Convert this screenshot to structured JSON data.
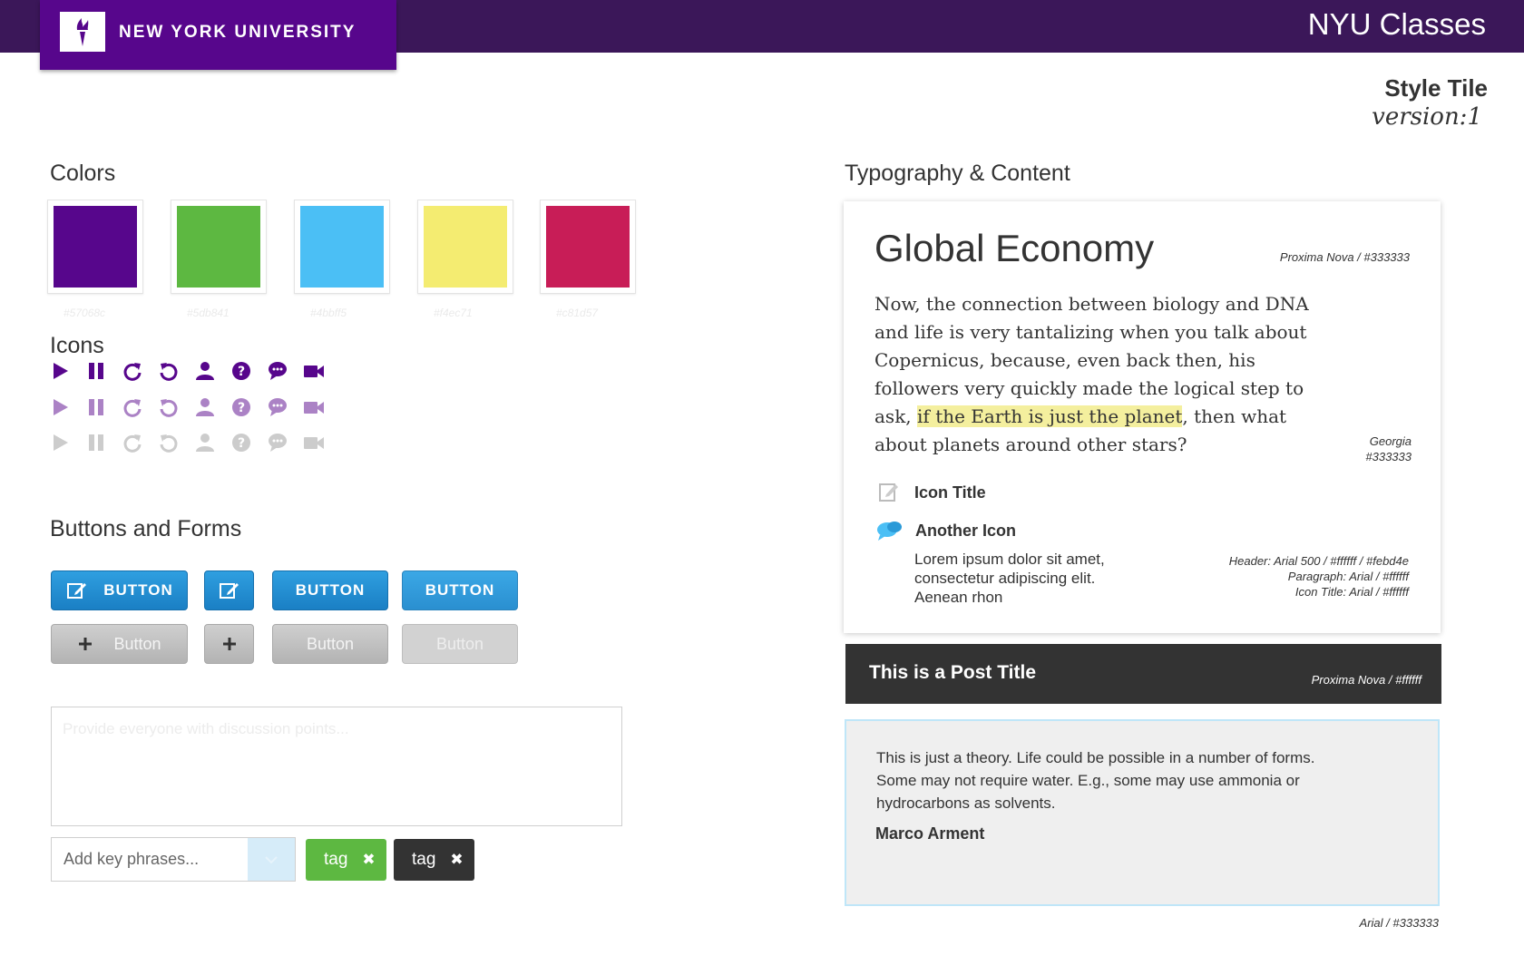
{
  "header": {
    "logo_text": "NEW YORK UNIVERSITY",
    "logo_icon": "torch-icon",
    "app_title": "NYU Classes",
    "tile_title": "Style Tile",
    "tile_version": "version:1"
  },
  "colors": {
    "title": "Colors",
    "swatches": [
      {
        "hex": "#57068c",
        "label": "#57068c"
      },
      {
        "hex": "#5db841",
        "label": "#5db841"
      },
      {
        "hex": "#4bbff5",
        "label": "#4bbff5"
      },
      {
        "hex": "#f4ec71",
        "label": "#f4ec71"
      },
      {
        "hex": "#c81d57",
        "label": "#c81d57"
      }
    ]
  },
  "icons": {
    "title": "Icons",
    "names": [
      "play-icon",
      "pause-icon",
      "redo-icon",
      "undo-icon",
      "user-icon",
      "help-icon",
      "chat-icon",
      "video-icon"
    ],
    "row_colors": [
      "#57068c",
      "#ab82c5",
      "#cccccc"
    ]
  },
  "forms": {
    "title": "Buttons and Forms",
    "button_label_caps": "BUTTON",
    "button_label": "Button",
    "textarea_placeholder": "Provide everyone with discussion points...",
    "keyphrase_placeholder": "Add key phrases...",
    "tag_label": "tag",
    "tag_green_color": "#5db841",
    "tag_dark_color": "#333333"
  },
  "typography": {
    "title": "Typography & Content",
    "headline": "Global Economy",
    "headline_note": "Proxima Nova / #333333",
    "paragraph_before": "Now, the connection between biology and DNA and life is very tantalizing when you talk about Copernicus, because, even back then, his followers very quickly made the logical step to ask, ",
    "paragraph_highlight": "if the Earth is just the planet",
    "paragraph_after": ", then what about planets around other stars?",
    "paragraph_note_line1": "Georgia",
    "paragraph_note_line2": "#333333",
    "icon_title": "Icon Title",
    "another_icon": "Another Icon",
    "lorem": "Lorem ipsum dolor sit amet, consectetur adipiscing elit. Aenean rhon",
    "icon_notes": [
      "Header: Arial 500 / #ffffff / #febd4e",
      "Paragraph: Arial / #ffffff",
      "Icon Title: Arial / #ffffff"
    ]
  },
  "post": {
    "title": "This is  a Post Title",
    "note": "Proxima Nova / #ffffff"
  },
  "quote": {
    "text": "This is just a theory. Life could be possible in a number of forms. Some may not require water. E.g., some may use ammonia or hydrocarbons as solvents.",
    "author": "Marco Arment",
    "note": "Arial / #333333"
  }
}
